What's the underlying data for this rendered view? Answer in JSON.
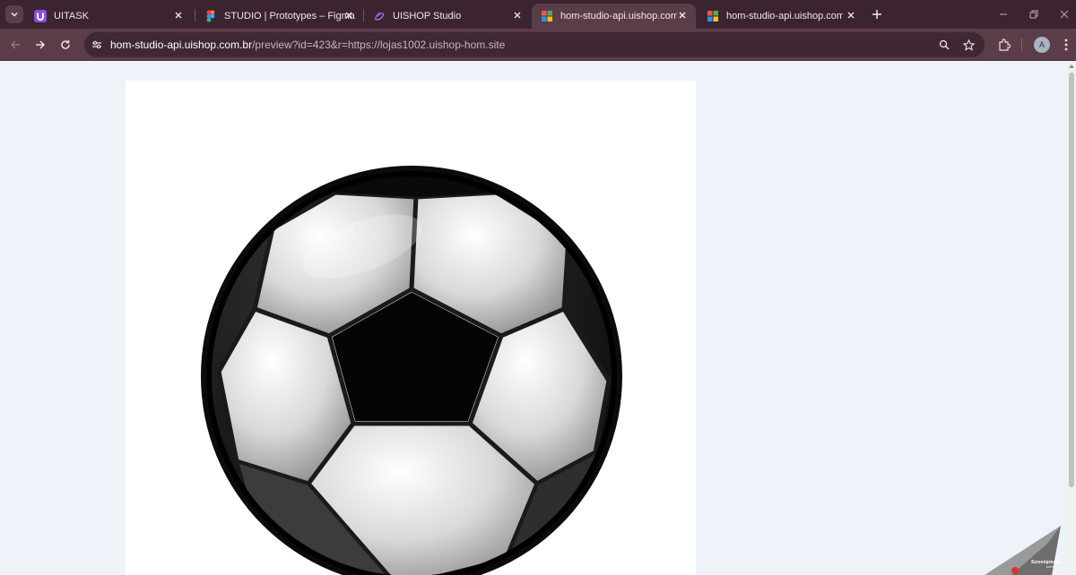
{
  "browser": {
    "tabs": [
      {
        "title": "UITASK",
        "icon": "uitask-logo",
        "active": false
      },
      {
        "title": "STUDIO | Prototypes – Figma",
        "icon": "figma-logo",
        "active": false
      },
      {
        "title": "UISHOP Studio",
        "icon": "uishop-logo",
        "active": false
      },
      {
        "title": "hom-studio-api.uishop.com.br/",
        "icon": "grid-favicon",
        "active": true
      },
      {
        "title": "hom-studio-api.uishop.com.br/",
        "icon": "grid-favicon",
        "active": false
      }
    ],
    "address": {
      "host": "hom-studio-api.uishop.com.br",
      "path": "/preview?id=423&r=https://lojas1002.uishop-hom.site"
    },
    "profile_initial": "A"
  },
  "colors": {
    "frame": "#3b2430",
    "toolbar": "#5a3d49",
    "page_background": "#eef3f9",
    "card_background": "#ffffff"
  },
  "page": {
    "image": "soccer-ball",
    "watermark": "Screenpresso.com"
  }
}
